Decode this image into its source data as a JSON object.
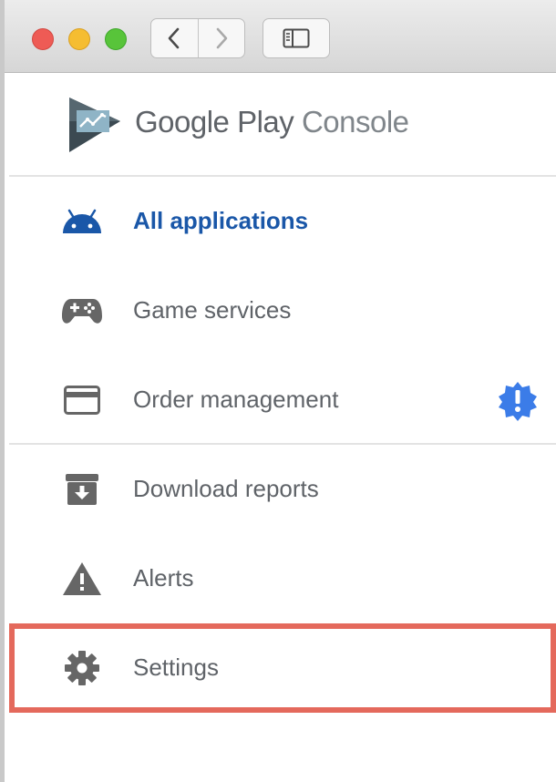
{
  "app": {
    "logo_text_primary": "Google Play",
    "logo_text_secondary": "Console"
  },
  "menu": {
    "items": [
      {
        "label": "All applications",
        "icon": "android-icon",
        "active": true
      },
      {
        "label": "Game services",
        "icon": "gamepad-icon"
      },
      {
        "label": "Order management",
        "icon": "credit-card-icon",
        "badge": "alert-badge-icon"
      },
      {
        "label": "Download reports",
        "icon": "download-archive-icon"
      },
      {
        "label": "Alerts",
        "icon": "warning-icon"
      },
      {
        "label": "Settings",
        "icon": "gear-icon",
        "highlighted": true
      }
    ]
  },
  "colors": {
    "active": "#1a57a8",
    "text": "#5f6368",
    "icon": "#666666",
    "badge": "#3b7ce8",
    "highlight": "#e4695c"
  }
}
